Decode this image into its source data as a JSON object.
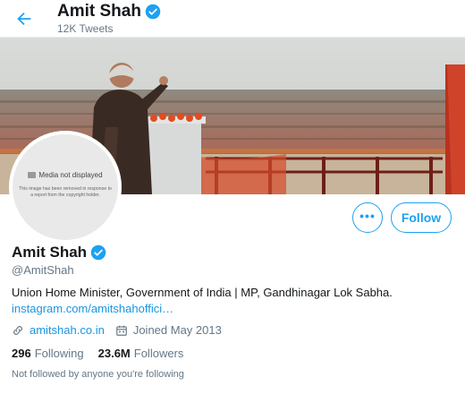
{
  "header": {
    "name": "Amit Shah",
    "tweet_count": "12K Tweets",
    "back_icon": "arrow-left-icon"
  },
  "avatar": {
    "media_title": "Media not displayed",
    "media_description": "This image has been removed in response to a report from the copyright holder."
  },
  "actions": {
    "more_label": "•••",
    "follow_label": "Follow"
  },
  "profile": {
    "name": "Amit Shah",
    "handle": "@AmitShah",
    "bio": "Union Home Minister, Government of India | MP, Gandhinagar Lok Sabha.",
    "bio_link": "instagram.com/amitshahoffici…",
    "website": "amitshah.co.in",
    "joined": "Joined May 2013",
    "verified_icon": "verified-badge-icon"
  },
  "stats": {
    "following_count": "296",
    "following_label": "Following",
    "followers_count": "23.6M",
    "followers_label": "Followers"
  },
  "followed_note": "Not followed by anyone you're following",
  "colors": {
    "accent": "#1da1f2",
    "link": "#1b95e0",
    "secondary_text": "#657786"
  }
}
